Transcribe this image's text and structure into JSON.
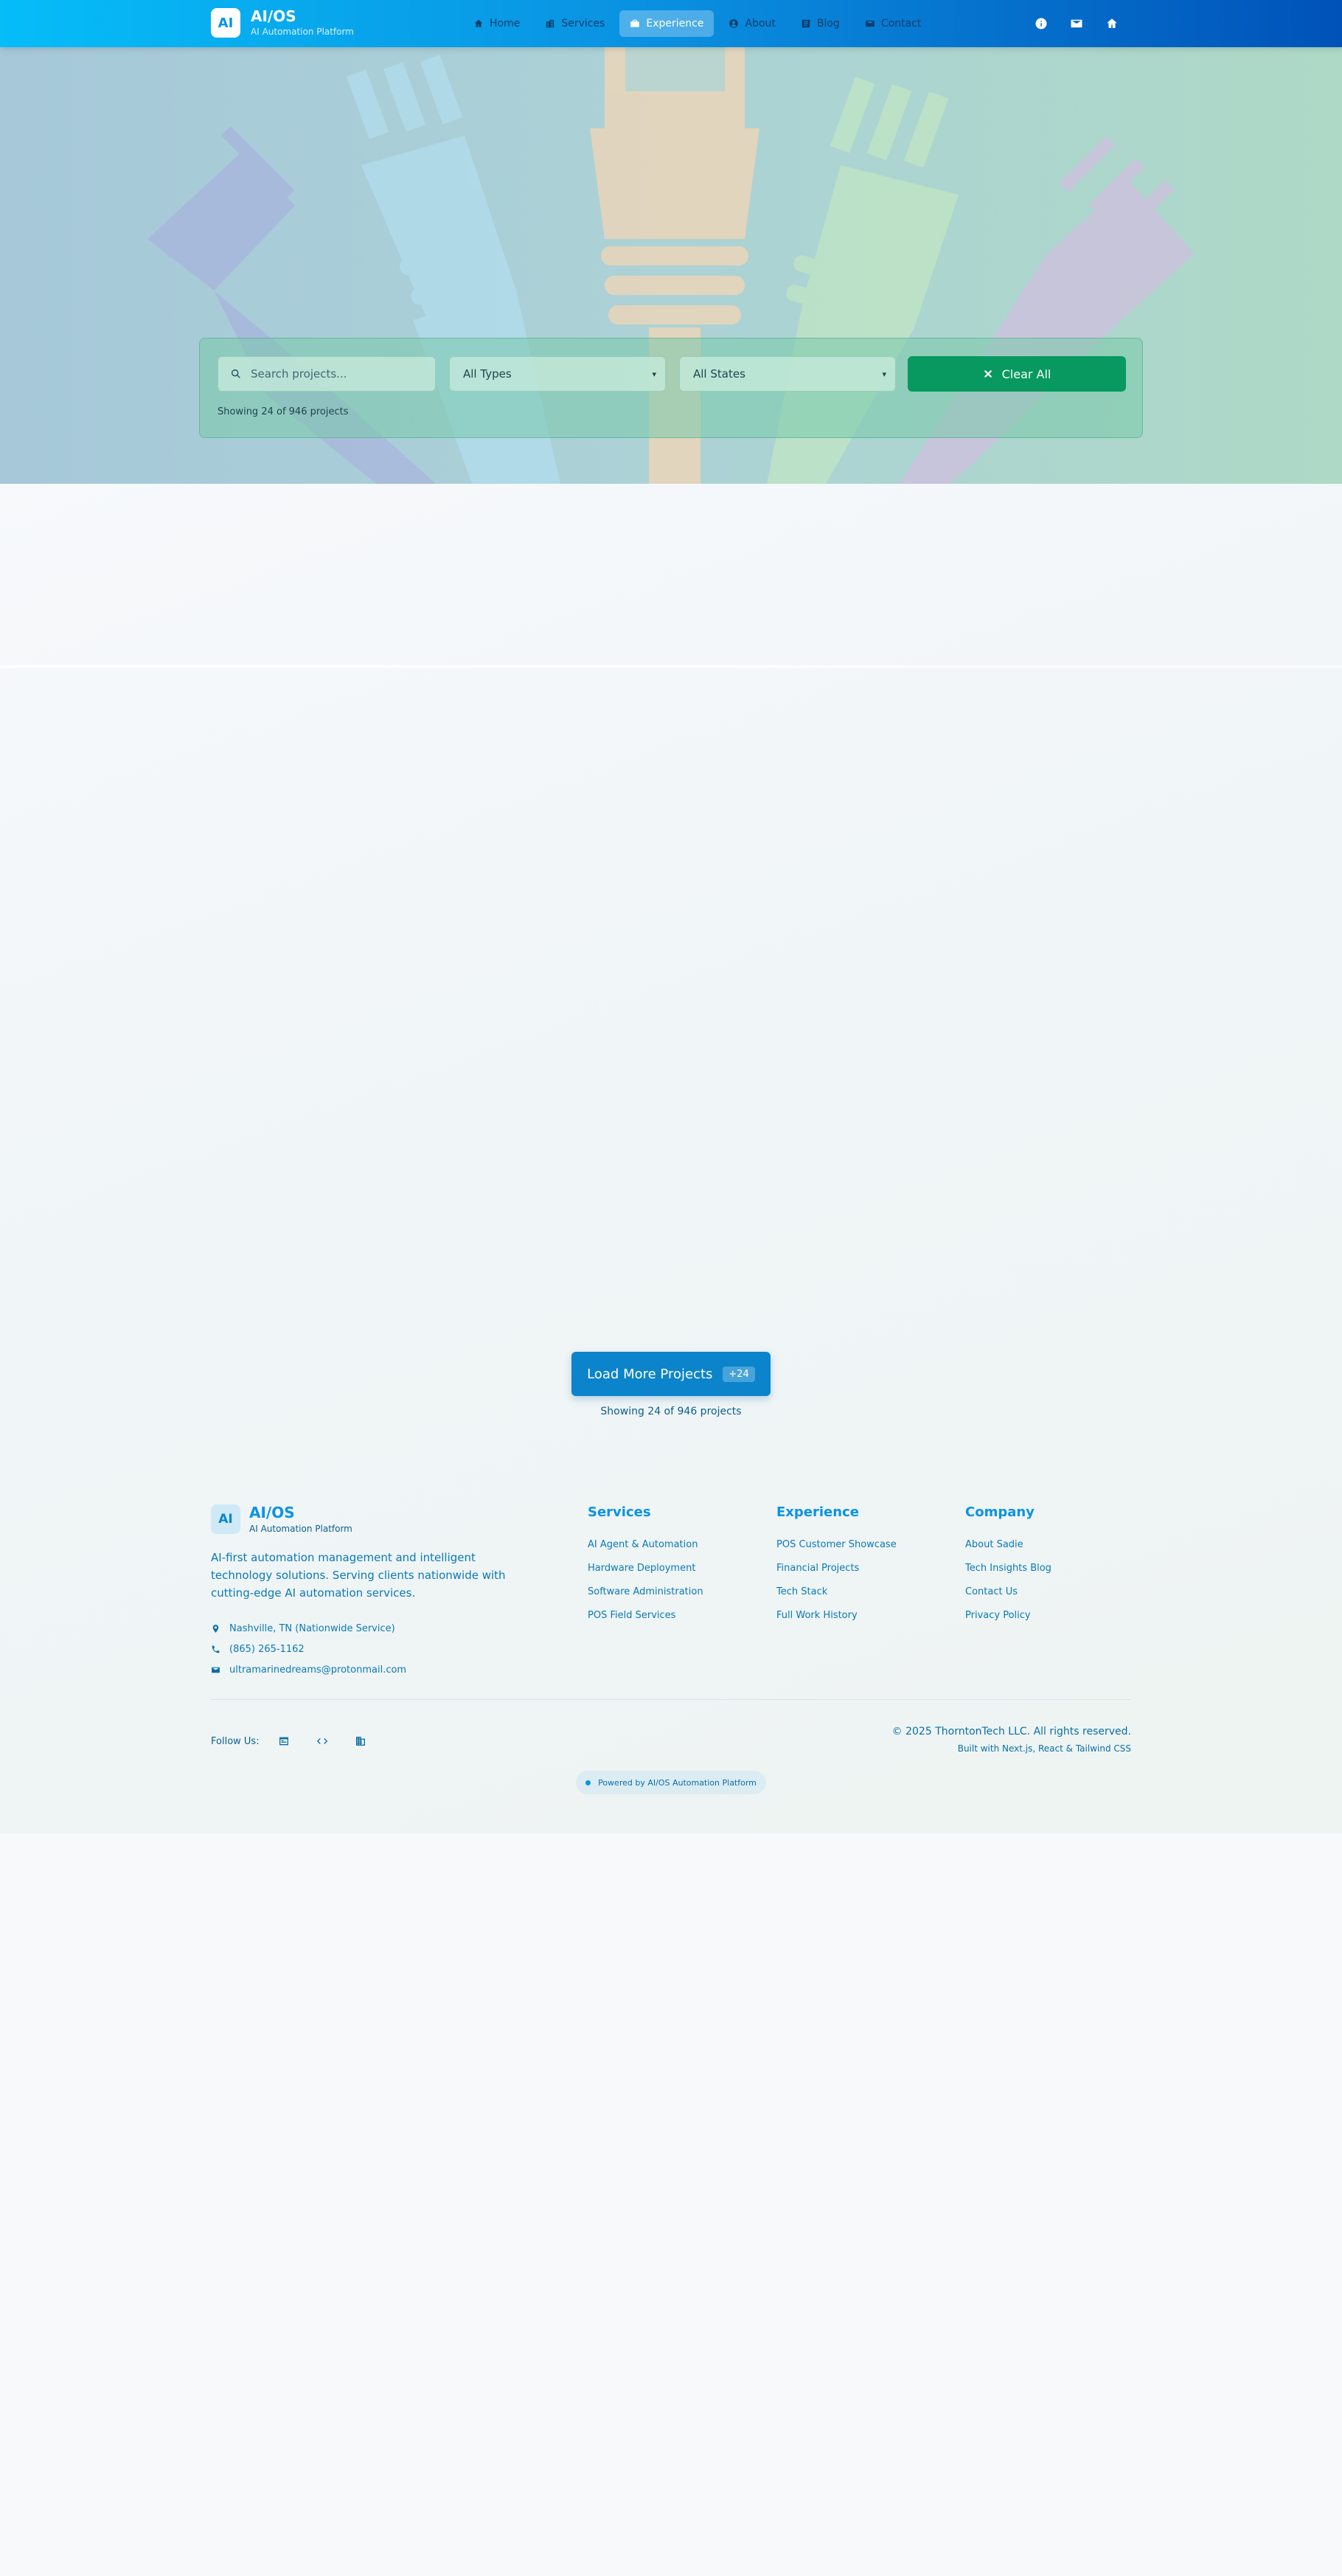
{
  "brand": {
    "logo": "AI",
    "title": "AI/OS",
    "subtitle": "AI Automation Platform"
  },
  "nav": {
    "links": [
      {
        "label": "Home",
        "icon": "home-icon"
      },
      {
        "label": "Services",
        "icon": "building-icon"
      },
      {
        "label": "Experience",
        "icon": "briefcase-icon",
        "active": true
      },
      {
        "label": "About",
        "icon": "user-circle-icon"
      },
      {
        "label": "Blog",
        "icon": "article-icon"
      },
      {
        "label": "Contact",
        "icon": "mail-icon"
      }
    ],
    "right_icons": [
      "info-icon",
      "mail-icon",
      "home-icon"
    ]
  },
  "filters": {
    "search_placeholder": "Search projects...",
    "types_selected": "All Types",
    "states_selected": "All States",
    "clear_label": "Clear All",
    "showing": "Showing 24 of 946 projects"
  },
  "load_more": {
    "label": "Load More Projects",
    "badge": "+24",
    "showing": "Showing 24 of 946 projects"
  },
  "footer": {
    "logo": "AI",
    "title": "AI/OS",
    "subtitle": "AI Automation Platform",
    "description": "AI-first automation management and intelligent technology solutions. Serving clients nationwide with cutting-edge AI automation services.",
    "contact": {
      "location": "Nashville, TN (Nationwide Service)",
      "phone": "(865) 265-1162",
      "email": "ultramarinedreams@protonmail.com"
    },
    "columns": {
      "services": {
        "heading": "Services",
        "links": [
          "AI Agent & Automation",
          "Hardware Deployment",
          "Software Administration",
          "POS Field Services"
        ]
      },
      "experience": {
        "heading": "Experience",
        "links": [
          "POS Customer Showcase",
          "Financial Projects",
          "Tech Stack",
          "Full Work History"
        ]
      },
      "company": {
        "heading": "Company",
        "links": [
          "About Sadie",
          "Tech Insights Blog",
          "Contact Us",
          "Privacy Policy"
        ]
      }
    },
    "follow_label": "Follow Us:",
    "social_icons": [
      "portfolio-icon",
      "code-icon",
      "building-icon"
    ],
    "copyright": "© 2025 ThorntonTech LLC. All rights reserved.",
    "built_with": "Built with Next.js, React & Tailwind CSS",
    "powered": "Powered by AI/OS Automation Platform"
  },
  "colors": {
    "nav_gradient_start": "#06bdf8",
    "nav_gradient_end": "#0052b8",
    "accent": "#0a93e6",
    "clear_button": "#07995f",
    "load_more_button": "#0b84cc"
  }
}
